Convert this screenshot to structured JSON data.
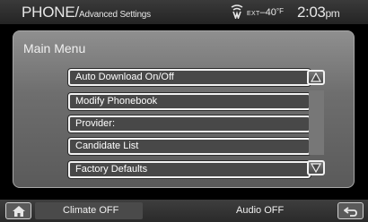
{
  "status_bar": {
    "title_main": "PHONE/",
    "title_sub": "Advanced Settings",
    "ext_label": "EXT",
    "temperature": "–40",
    "temperature_unit": "°F",
    "time": "2:03",
    "ampm": "pm",
    "wifi_icon": "wifi-signal-icon"
  },
  "panel": {
    "title": "Main Menu",
    "items": [
      {
        "label": "Auto Download On/Off"
      },
      {
        "label": "Modify Phonebook"
      },
      {
        "label": "Provider:"
      },
      {
        "label": "Candidate List"
      },
      {
        "label": "Factory Defaults"
      }
    ],
    "scroll_up_icon": "triangle-up-icon",
    "scroll_down_icon": "triangle-down-icon"
  },
  "bottom_bar": {
    "home_icon": "home-icon",
    "climate_label": "Climate OFF",
    "audio_label": "Audio OFF",
    "back_icon": "back-arrow-icon"
  }
}
